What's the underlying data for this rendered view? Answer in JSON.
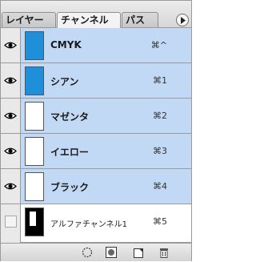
{
  "tabs": [
    {
      "label": "レイヤー",
      "active": false
    },
    {
      "label": "チャンネル",
      "active": true
    },
    {
      "label": "パス",
      "active": false
    }
  ],
  "channels": [
    {
      "name": "CMYK",
      "shortcut": "⌘^",
      "visible": true,
      "selected": true,
      "thumb": "blue"
    },
    {
      "name": "シアン",
      "shortcut": "⌘1",
      "visible": true,
      "selected": true,
      "thumb": "blue"
    },
    {
      "name": "マゼンタ",
      "shortcut": "⌘2",
      "visible": true,
      "selected": true,
      "thumb": "white"
    },
    {
      "name": "イエロー",
      "shortcut": "⌘3",
      "visible": true,
      "selected": true,
      "thumb": "white"
    },
    {
      "name": "ブラック",
      "shortcut": "⌘4",
      "visible": true,
      "selected": true,
      "thumb": "white"
    },
    {
      "name": "アルファチャンネル1",
      "shortcut": "⌘5",
      "visible": false,
      "selected": false,
      "thumb": "black"
    }
  ],
  "bottom_buttons": [
    "load-selection-icon",
    "save-selection-icon",
    "new-channel-icon",
    "trash-icon"
  ],
  "colors": {
    "selected_row": "#c2d9f5",
    "thumb_blue": "#1e8fd8"
  }
}
